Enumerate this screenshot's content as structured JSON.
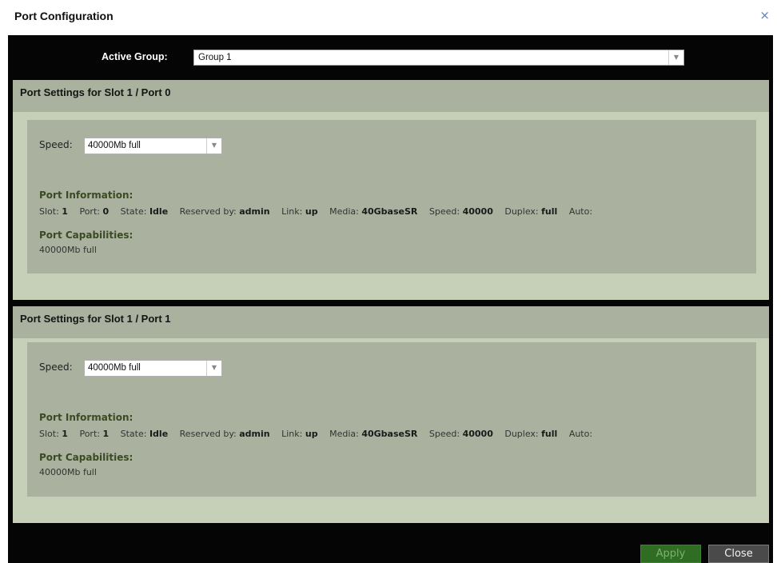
{
  "dialog": {
    "title": "Port Configuration",
    "close_glyph": "×"
  },
  "active_group": {
    "label": "Active Group:",
    "value": "Group 1"
  },
  "panels": [
    {
      "title": "Port Settings for Slot 1 / Port 0",
      "speed_label": "Speed:",
      "speed_value": "40000Mb full",
      "info_heading": "Port Information:",
      "info": {
        "slot_label": "Slot:",
        "slot": "1",
        "port_label": "Port:",
        "port": "0",
        "state_label": "State:",
        "state": "Idle",
        "reserved_label": "Reserved by:",
        "reserved": "admin",
        "link_label": "Link:",
        "link": "up",
        "media_label": "Media:",
        "media": "40GbaseSR",
        "speed_label": "Speed:",
        "speed": "40000",
        "duplex_label": "Duplex:",
        "duplex": "full",
        "auto_label": "Auto:",
        "auto": ""
      },
      "cap_heading": "Port Capabilities:",
      "capabilities": "40000Mb full"
    },
    {
      "title": "Port Settings for Slot 1 / Port 1",
      "speed_label": "Speed:",
      "speed_value": "40000Mb full",
      "info_heading": "Port Information:",
      "info": {
        "slot_label": "Slot:",
        "slot": "1",
        "port_label": "Port:",
        "port": "1",
        "state_label": "State:",
        "state": "Idle",
        "reserved_label": "Reserved by:",
        "reserved": "admin",
        "link_label": "Link:",
        "link": "up",
        "media_label": "Media:",
        "media": "40GbaseSR",
        "speed_label": "Speed:",
        "speed": "40000",
        "duplex_label": "Duplex:",
        "duplex": "full",
        "auto_label": "Auto:",
        "auto": ""
      },
      "cap_heading": "Port Capabilities:",
      "capabilities": "40000Mb full"
    }
  ],
  "buttons": {
    "apply": "Apply",
    "close": "Close"
  },
  "icons": {
    "dropdown": "chevron-down-icon",
    "close": "close-icon"
  },
  "colors": {
    "panel_bg": "#c6d0b8",
    "panel_header": "#aab19e",
    "apply_bg": "#2e6d22",
    "close_bg": "#4a4a4a"
  }
}
